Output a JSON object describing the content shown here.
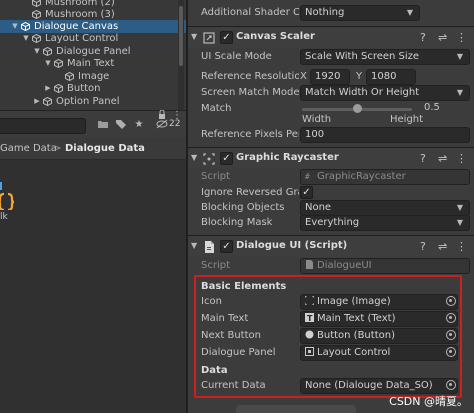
{
  "hierarchy": {
    "rows": [
      {
        "label": "Mushroom (2)",
        "indent": 2,
        "arrow": "",
        "selected": false
      },
      {
        "label": "Mushroom (3)",
        "indent": 2,
        "arrow": "",
        "selected": false
      },
      {
        "label": "Dialogue Canvas",
        "indent": 1,
        "arrow": "▼",
        "selected": true
      },
      {
        "label": "Layout Control",
        "indent": 2,
        "arrow": "▼",
        "selected": false
      },
      {
        "label": "Dialogue Panel",
        "indent": 3,
        "arrow": "▼",
        "selected": false
      },
      {
        "label": "Main Text",
        "indent": 4,
        "arrow": "▼",
        "selected": false
      },
      {
        "label": "Image",
        "indent": 5,
        "arrow": "",
        "selected": false
      },
      {
        "label": "Button",
        "indent": 4,
        "arrow": "▶",
        "selected": false
      },
      {
        "label": "Option Panel",
        "indent": 3,
        "arrow": "▶",
        "selected": false
      }
    ]
  },
  "project": {
    "toolbar": {
      "hidden_count": "22"
    },
    "breadcrumb": {
      "parent": "Game Data",
      "separator": ">",
      "current": "Dialogue Data"
    },
    "asset_label": "lk"
  },
  "inspector": {
    "additional_shader": {
      "label": "Additional Shader Ch",
      "value": "Nothing"
    },
    "canvas_scaler": {
      "title": "Canvas Scaler",
      "ui_scale_mode": {
        "label": "UI Scale Mode",
        "value": "Scale With Screen Size"
      },
      "reference_resolution": {
        "label": "Reference Resolution",
        "x_label": "X",
        "x_value": "1920",
        "y_label": "Y",
        "y_value": "1080"
      },
      "screen_match_mode": {
        "label": "Screen Match Mode",
        "value": "Match Width Or Height"
      },
      "match": {
        "label": "Match",
        "value": "0.5",
        "fraction": 0.5,
        "left_caption": "Width",
        "right_caption": "Height"
      },
      "pixels_per_unit": {
        "label": "Reference Pixels Per",
        "value": "100"
      }
    },
    "graphic_raycaster": {
      "title": "Graphic Raycaster",
      "script": {
        "label": "Script",
        "value": "GraphicRaycaster"
      },
      "ignore_reversed": {
        "label": "Ignore Reversed Grap",
        "checked": "✓"
      },
      "blocking_objects": {
        "label": "Blocking Objects",
        "value": "None"
      },
      "blocking_mask": {
        "label": "Blocking Mask",
        "value": "Everything"
      }
    },
    "dialogue_ui": {
      "title": "Dialogue UI (Script)",
      "script": {
        "label": "Script",
        "value": "DialogueUI"
      },
      "basic_elements": {
        "title": "Basic Elements",
        "fields": [
          {
            "label": "Icon",
            "value": "Image (Image)",
            "icon": "image-icon"
          },
          {
            "label": "Main Text",
            "value": "Main Text (Text)",
            "icon": "text-icon"
          },
          {
            "label": "Next Button",
            "value": "Button (Button)",
            "icon": "button-icon"
          },
          {
            "label": "Dialogue Panel",
            "value": "Layout Control",
            "icon": "rect-transform-icon"
          }
        ]
      },
      "data": {
        "title": "Data",
        "current_data": {
          "label": "Current Data",
          "value": "None (Dialouge Data_SO)"
        }
      }
    }
  },
  "watermark": "CSDN @晴夏。",
  "colors": {
    "selection": "#2c5d87",
    "highlight": "#cc1f1f",
    "panel": "#3c3c3c",
    "field": "#2a2a2a"
  }
}
